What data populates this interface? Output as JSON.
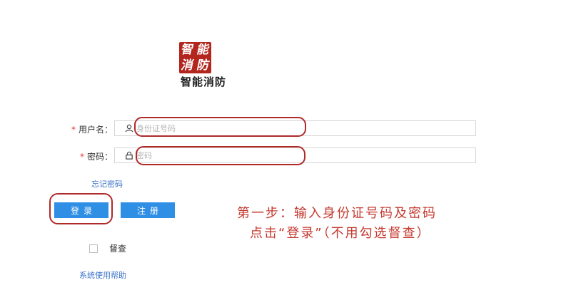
{
  "logo": {
    "glyphs": [
      "智",
      "能",
      "消",
      "防"
    ],
    "brand_name": "智能消防",
    "color": "#b3261e"
  },
  "form": {
    "username": {
      "required_mark": "*",
      "label": "用户名：",
      "icon": "user-icon",
      "placeholder": "身份证号码",
      "value": ""
    },
    "password": {
      "required_mark": "*",
      "label": "密码：",
      "icon": "lock-icon",
      "placeholder": "密码",
      "value": ""
    },
    "forgot_password": "忘记密码",
    "login_button": "登录",
    "register_button": "注册",
    "supervise_checkbox": {
      "label": "督查",
      "checked": false
    },
    "help_link": "系统使用帮助"
  },
  "annotation": {
    "line1": "第一步：输入身份证号码及密码",
    "line2": "点击“登录”（不用勾选督查）",
    "color": "#c43a2f"
  },
  "colors": {
    "primary_button": "#2f8fe4",
    "link": "#3a73c9",
    "required": "#e33b3b",
    "highlight_oval": "#b02a2a"
  }
}
